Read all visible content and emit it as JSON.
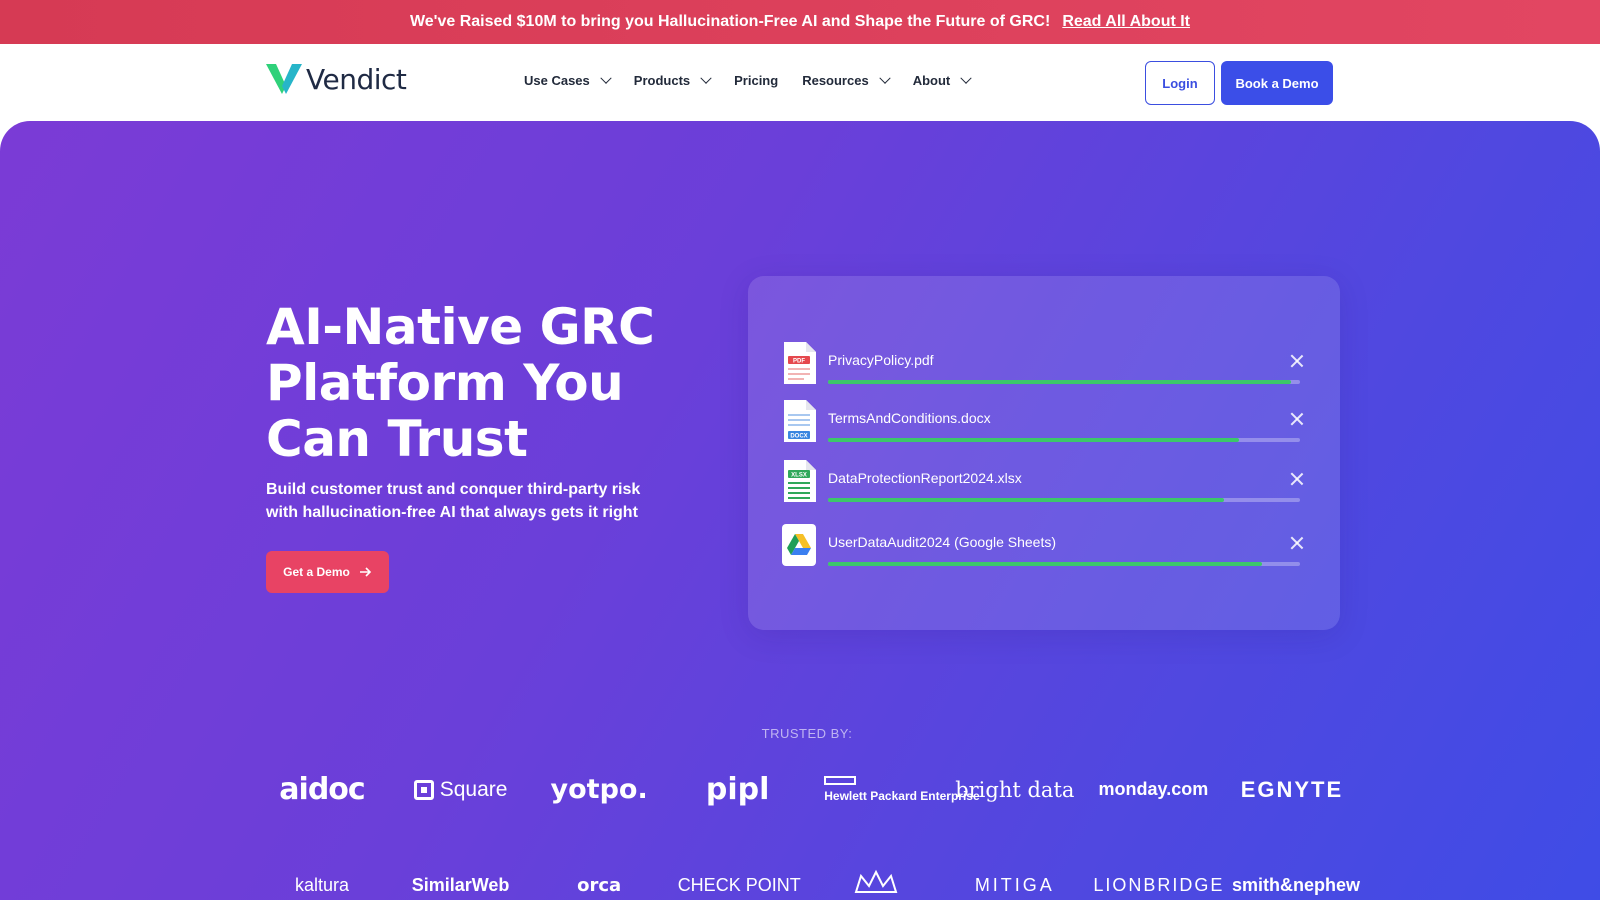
{
  "announcement": {
    "text": "We've Raised $10M to bring you Hallucination-Free AI and Shape the Future of GRC!",
    "link": "Read All About It"
  },
  "nav": {
    "logo_text": "Vendict",
    "items": [
      {
        "label": "Use Cases",
        "has_dropdown": true
      },
      {
        "label": "Products",
        "has_dropdown": true
      },
      {
        "label": "Pricing",
        "has_dropdown": false
      },
      {
        "label": "Resources",
        "has_dropdown": true
      },
      {
        "label": "About",
        "has_dropdown": true
      }
    ],
    "login": "Login",
    "book_demo": "Book a Demo"
  },
  "hero": {
    "title": "AI-Native GRC Platform You Can Trust",
    "subtitle": "Build customer trust and conquer third-party risk with hallucination-free AI that always gets it right",
    "cta": "Get a Demo"
  },
  "uploads": [
    {
      "name": "PrivacyPolicy.pdf",
      "type": "pdf",
      "icon": "pdf-file-icon",
      "progress": 0.98
    },
    {
      "name": "TermsAndConditions.docx",
      "type": "docx",
      "icon": "docx-file-icon",
      "progress": 0.87
    },
    {
      "name": "DataProtectionReport2024.xlsx",
      "type": "xlsx",
      "icon": "xlsx-file-icon",
      "progress": 0.84
    },
    {
      "name": "UserDataAudit2024 (Google Sheets)",
      "type": "gsheets",
      "icon": "google-drive-icon",
      "progress": 0.92
    }
  ],
  "trusted": {
    "label": "TRUSTED BY:",
    "row1": [
      "aidoc",
      "Square",
      "yotpo.",
      "pipl",
      "Hewlett Packard Enterprise",
      "bright data",
      "monday.com",
      "EGNYTE"
    ],
    "row2": [
      "kaltura",
      "SimilarWeb",
      "orca",
      "CHECK POINT",
      "",
      "MITIGA",
      "LIONBRIDGE",
      "smith&nephew"
    ]
  },
  "colors": {
    "announce_bg": "#e0415d",
    "primary_blue": "#3b4ee8",
    "cta_red": "#e84364",
    "hero_gradient_start": "#7b3bd6",
    "hero_gradient_end": "#3f4ce6",
    "progress_green": "#3cc76a"
  }
}
